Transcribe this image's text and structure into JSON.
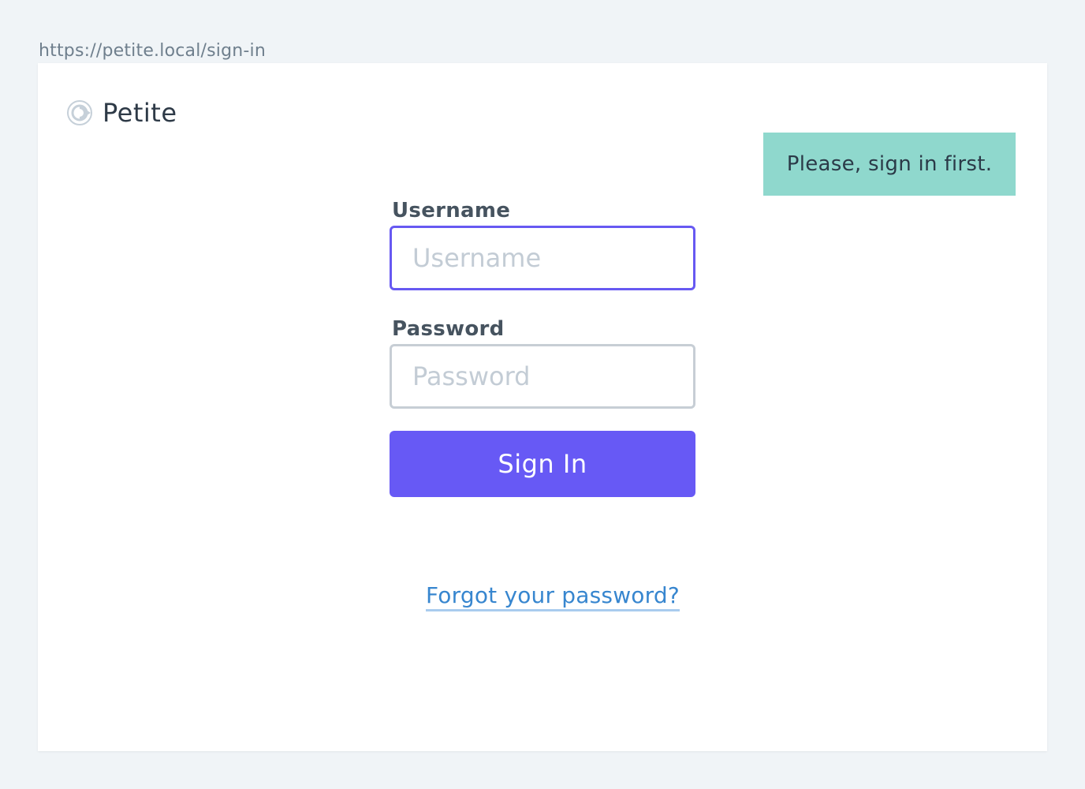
{
  "browser": {
    "url": "https://petite.local/sign-in"
  },
  "brand": {
    "name": "Petite",
    "icon": "petite-logo-icon"
  },
  "notice": {
    "text": "Please, sign in first.",
    "color": "#8fd8cd"
  },
  "form": {
    "username": {
      "label": "Username",
      "placeholder": "Username",
      "value": ""
    },
    "password": {
      "label": "Password",
      "placeholder": "Password",
      "value": ""
    },
    "submit_label": "Sign In",
    "forgot_link": "Forgot your password?"
  },
  "colors": {
    "accent": "#6759f5",
    "link": "#3786cf",
    "background": "#f0f4f7"
  }
}
